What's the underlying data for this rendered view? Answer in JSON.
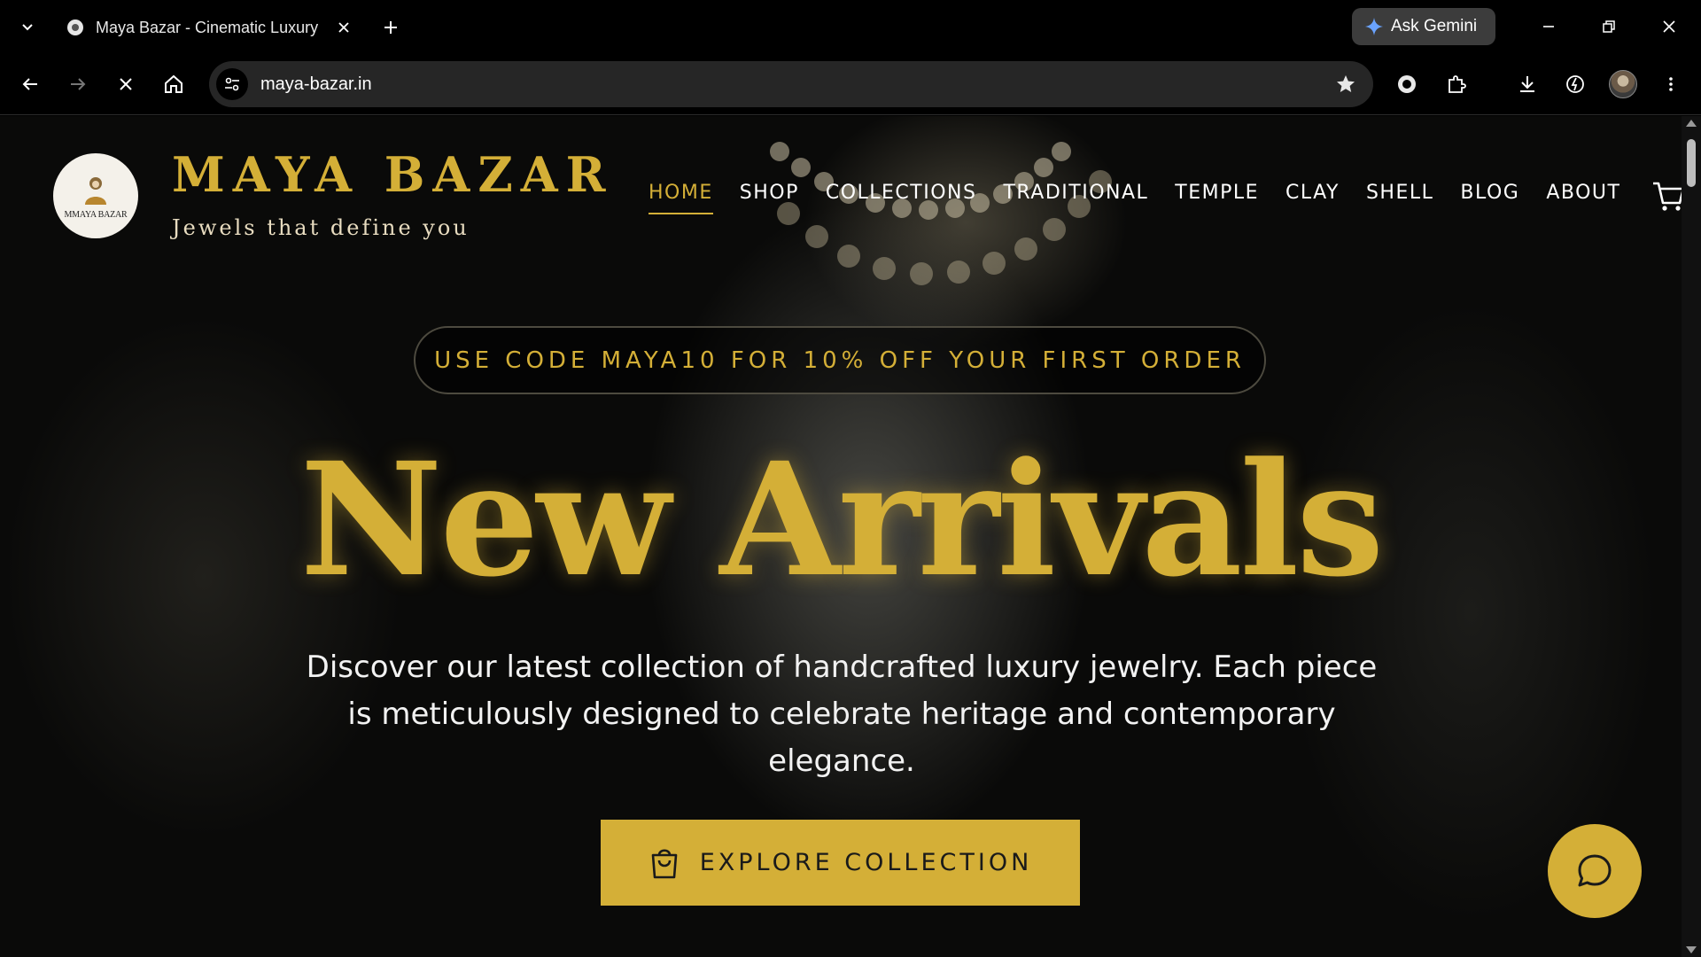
{
  "browser": {
    "tab": {
      "title": "Maya Bazar - Cinematic Luxury"
    },
    "gemini": {
      "label": "Ask Gemini"
    },
    "omnibox": {
      "url": "maya-bazar.in"
    }
  },
  "site": {
    "logo": {
      "text": "MMAYA BAZAR"
    },
    "brand": {
      "name": "MAYA BAZAR",
      "tagline": "Jewels that define you"
    },
    "nav": [
      {
        "label": "HOME",
        "active": true
      },
      {
        "label": "SHOP"
      },
      {
        "label": "COLLECTIONS"
      },
      {
        "label": "TRADITIONAL"
      },
      {
        "label": "TEMPLE"
      },
      {
        "label": "CLAY"
      },
      {
        "label": "SHELL"
      },
      {
        "label": "BLOG"
      },
      {
        "label": "ABOUT"
      }
    ],
    "promo": {
      "text": "USE CODE MAYA10 FOR 10% OFF YOUR FIRST ORDER"
    },
    "hero": {
      "title": "New Arrivals",
      "description": "Discover our latest collection of handcrafted luxury jewelry. Each piece is meticulously designed to celebrate heritage and contemporary elegance.",
      "cta_label": "EXPLORE COLLECTION"
    }
  },
  "colors": {
    "accent_gold": "#d4af37",
    "page_background": "#0a0a09",
    "chrome_background": "#000000"
  }
}
